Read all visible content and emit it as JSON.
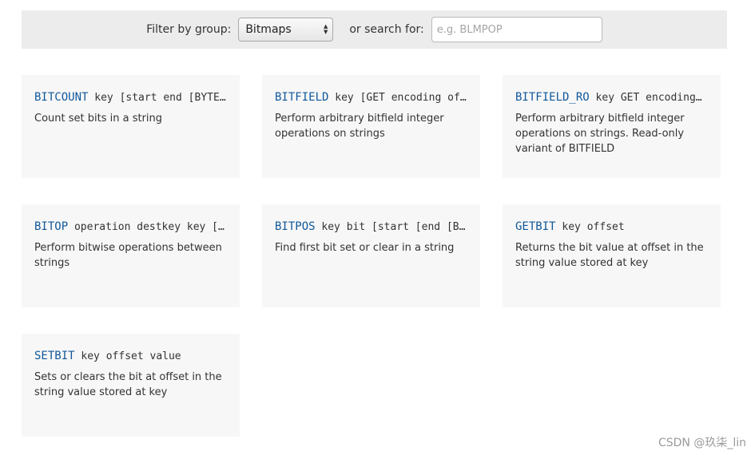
{
  "filter": {
    "label": "Filter by group:",
    "selected_group": "Bitmaps",
    "search_label": "or search for:",
    "search_placeholder": "e.g. BLMPOP",
    "search_value": ""
  },
  "commands": [
    {
      "name": "BITCOUNT",
      "args": "key [start end [BYTE|BIT]]",
      "description": "Count set bits in a string"
    },
    {
      "name": "BITFIELD",
      "args": "key [GET encoding offset",
      "description": "Perform arbitrary bitfield integer operations on strings"
    },
    {
      "name": "BITFIELD_RO",
      "args": "key GET encoding offset",
      "description": "Perform arbitrary bitfield integer operations on strings. Read-only variant of BITFIELD"
    },
    {
      "name": "BITOP",
      "args": "operation destkey key [key",
      "description": "Perform bitwise operations between strings"
    },
    {
      "name": "BITPOS",
      "args": "key bit [start [end [BYTE",
      "description": "Find first bit set or clear in a string"
    },
    {
      "name": "GETBIT",
      "args": "key offset",
      "description": "Returns the bit value at offset in the string value stored at key"
    },
    {
      "name": "SETBIT",
      "args": "key offset value",
      "description": "Sets or clears the bit at offset in the string value stored at key"
    }
  ],
  "watermark": "CSDN @玖柒_lin",
  "colors": {
    "command_name": "#10589a",
    "card_bg": "#f7f7f7",
    "filter_bar_bg": "#ececec"
  }
}
